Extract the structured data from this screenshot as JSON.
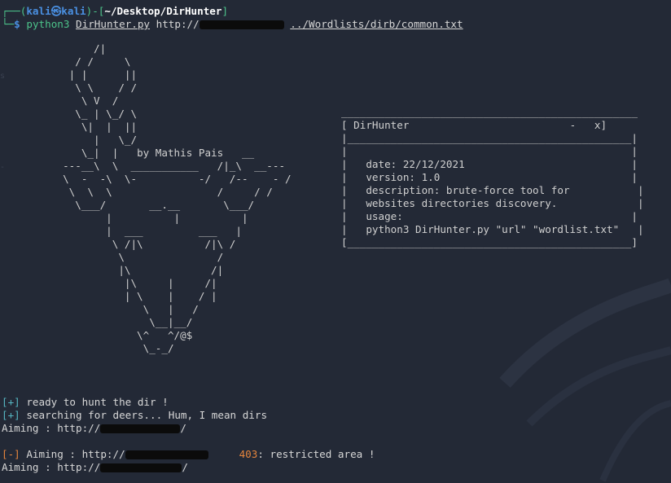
{
  "prompt": {
    "user": "kali",
    "host": "kali",
    "path": "~/Desktop/DirHunter",
    "command": "python3",
    "script": "DirHunter.py",
    "url_prefix": "http://",
    "wordlist": "../Wordlists/dirb/common.txt"
  },
  "ascii_art": {
    "credit": "by Mathis Pais"
  },
  "info_box": {
    "title": "DirHunter",
    "window_buttons": "-   x",
    "date_label": "date: 22/12/2021",
    "version_label": "version: 1.0",
    "description_line1": "description: brute-force tool for",
    "description_line2": "websites directories discovery.",
    "usage_label": "usage:",
    "usage_example": "python3 DirHunter.py \"url\" \"wordlist.txt\""
  },
  "output": {
    "line1_tag": "[+]",
    "line1_text": "ready to hunt the dir !",
    "line2_tag": "[+]",
    "line2_text": "searching for deers... Hum, I mean dirs",
    "line3_text": "Aiming : http://",
    "line3_suffix": "/",
    "line4_tag": "[-]",
    "line4_text": "Aiming : http://",
    "line4_code": "403",
    "line4_msg": ": restricted area !",
    "line5_text": "Aiming : http://",
    "line5_suffix": "/"
  },
  "colors": {
    "background": "#232936",
    "prompt_green": "#4cc38a",
    "prompt_blue": "#4a90e2",
    "status_orange": "#e5853d",
    "tag_cyan": "#56b6c2"
  }
}
